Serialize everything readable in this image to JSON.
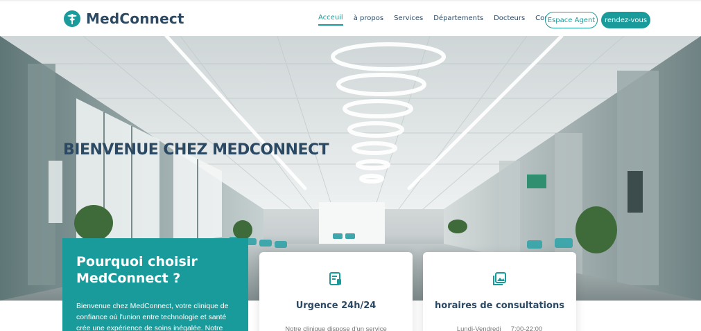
{
  "header": {
    "logo_text": "MedConnect",
    "nav": [
      {
        "label": "Acceuil",
        "active": true
      },
      {
        "label": "à propos",
        "active": false
      },
      {
        "label": "Services",
        "active": false
      },
      {
        "label": "Départements",
        "active": false
      },
      {
        "label": "Docteurs",
        "active": false
      },
      {
        "label": "Contact",
        "active": false
      }
    ],
    "agent_button": "Espace Agent",
    "appointment_button": "rendez-vous"
  },
  "hero": {
    "title": "BIENVENUE CHEZ MEDCONNECT"
  },
  "why": {
    "title_line1": "Pourquoi choisir",
    "title_line2": "MedConnect ?",
    "text_line1": "Bienvenue chez MedConnect, votre clinique de",
    "text_line2": "confiance où l'union entre technologie et santé",
    "text_line3": "crée une expérience de soins inégalée. Notre"
  },
  "cards": [
    {
      "icon": "clipboard-icon",
      "title": "Urgence 24h/24",
      "text": "Notre clinique dispose d'un service"
    },
    {
      "icon": "images-icon",
      "title": "horaires de consultations",
      "day": "Lundi-Vendredi",
      "hours": "7:00-22:00"
    }
  ],
  "colors": {
    "accent": "#1a9b9b",
    "heading": "#2c4964",
    "text_muted": "#777777"
  }
}
